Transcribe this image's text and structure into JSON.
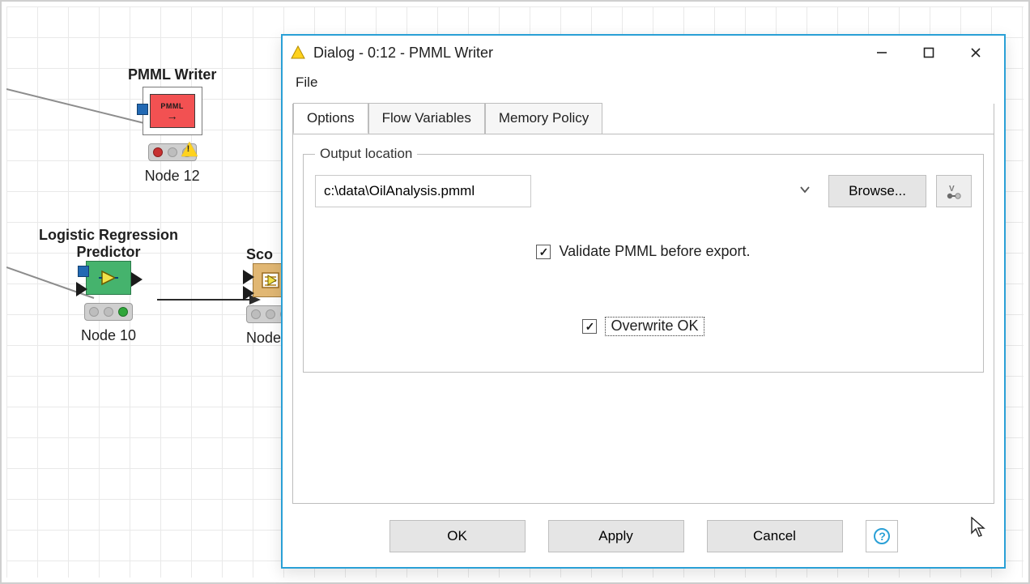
{
  "canvas": {
    "nodes": {
      "pmml_writer": {
        "title": "PMML Writer",
        "caption": "Node 12",
        "body_text": "PMML"
      },
      "lr_predictor": {
        "title_line1": "Logistic Regression",
        "title_line2": "Predictor",
        "caption": "Node 10"
      },
      "scorer": {
        "title_partial": "Sco",
        "caption_partial": "Node"
      }
    }
  },
  "dialog": {
    "title": "Dialog - 0:12 - PMML Writer",
    "menu": {
      "file": "File"
    },
    "tabs": {
      "options": "Options",
      "flow_variables": "Flow Variables",
      "memory_policy": "Memory Policy"
    },
    "fieldset_legend": "Output location",
    "path_value": "c:\\data\\OilAnalysis.pmml",
    "browse_label": "Browse...",
    "validate_label": "Validate PMML before export.",
    "overwrite_label": "Overwrite OK",
    "buttons": {
      "ok": "OK",
      "apply": "Apply",
      "cancel": "Cancel"
    }
  }
}
